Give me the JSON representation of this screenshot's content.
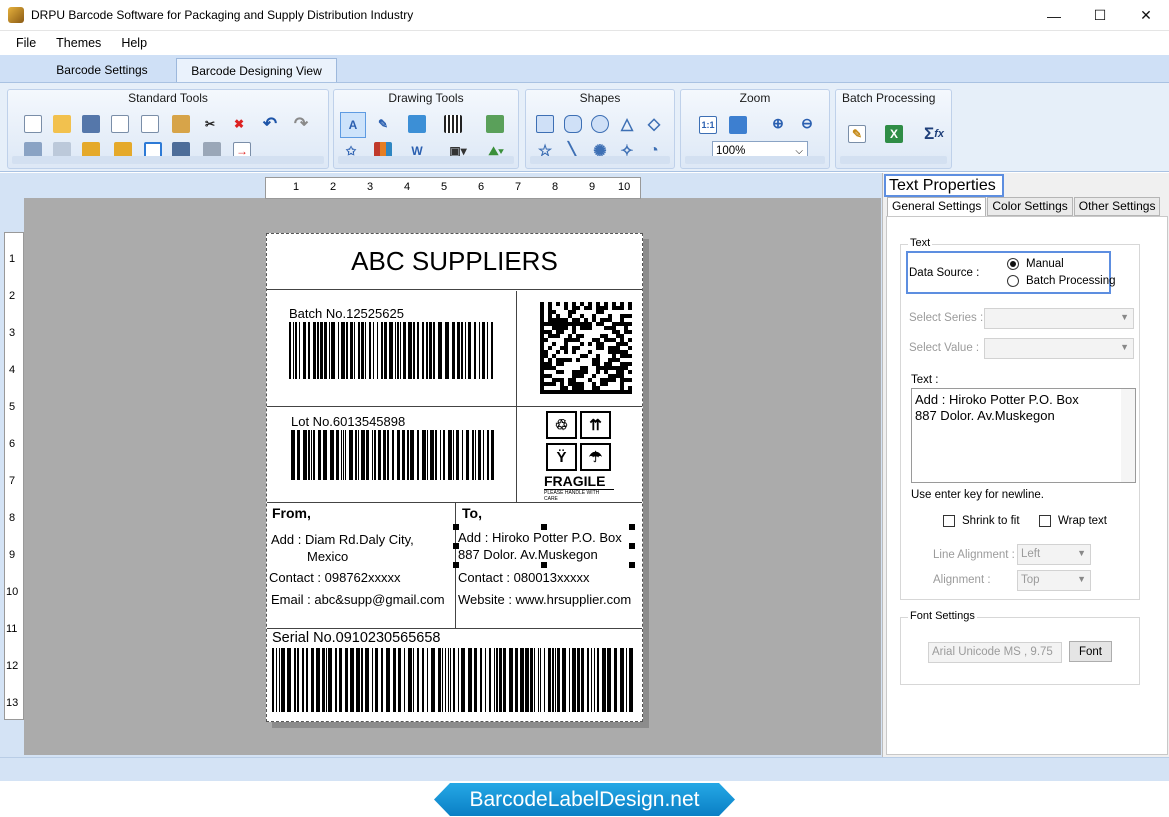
{
  "window": {
    "title": "DRPU Barcode Software for Packaging and Supply Distribution Industry",
    "min": "—",
    "max": "☐",
    "close": "✕"
  },
  "menu": [
    "File",
    "Themes",
    "Help"
  ],
  "tabs": {
    "settings": "Barcode Settings",
    "design": "Barcode Designing View"
  },
  "ribbon": {
    "standard_tools": "Standard Tools",
    "drawing_tools": "Drawing Tools",
    "shapes": "Shapes",
    "zoom": "Zoom",
    "zoom_value": "100%",
    "batch": "Batch Processing"
  },
  "ruler": {
    "h": [
      "1",
      "2",
      "3",
      "4",
      "5",
      "6",
      "7",
      "8",
      "9",
      "10"
    ],
    "v": [
      "1",
      "2",
      "3",
      "4",
      "5",
      "6",
      "7",
      "8",
      "9",
      "10",
      "11",
      "12",
      "13"
    ]
  },
  "label": {
    "title": "ABC SUPPLIERS",
    "batch": "Batch No.12525625",
    "lot": "Lot No.6013545898",
    "fragile": "FRAGILE",
    "fragile_sub": "PLEASE HANDLE WITH CARE",
    "from_head": "From,",
    "from_addr1": "Add : Diam Rd.Daly City,",
    "from_addr2": "Mexico",
    "from_contact": "Contact : 098762xxxxx",
    "from_email": "Email : abc&supp@gmail.com",
    "to_head": "To,",
    "to_addr1": "Add : Hiroko Potter P.O. Box",
    "to_addr2": "887  Dolor. Av.Muskegon",
    "to_contact": "Contact : 080013xxxxx",
    "to_web": "Website : www.hrsupplier.com",
    "serial": "Serial No.0910230565658"
  },
  "panel": {
    "title": "Text Properties",
    "tabs": [
      "General Settings",
      "Color Settings",
      "Other Settings"
    ],
    "text_legend": "Text",
    "data_source": "Data Source :",
    "manual": "Manual",
    "batch_processing": "Batch Processing",
    "select_series": "Select Series :",
    "select_value": "Select Value :",
    "text_label": "Text :",
    "text_line1": "Add : Hiroko Potter P.O. Box",
    "text_line2": "887  Dolor. Av.Muskegon",
    "hint": "Use enter key for newline.",
    "shrink": "Shrink to fit",
    "wrap": "Wrap text",
    "line_alignment": "Line Alignment :",
    "line_alignment_value": "Left",
    "alignment": "Alignment :",
    "alignment_value": "Top",
    "font_legend": "Font Settings",
    "font_value": "Arial Unicode MS , 9.75",
    "font_button": "Font"
  },
  "banner": "BarcodeLabelDesign.net"
}
